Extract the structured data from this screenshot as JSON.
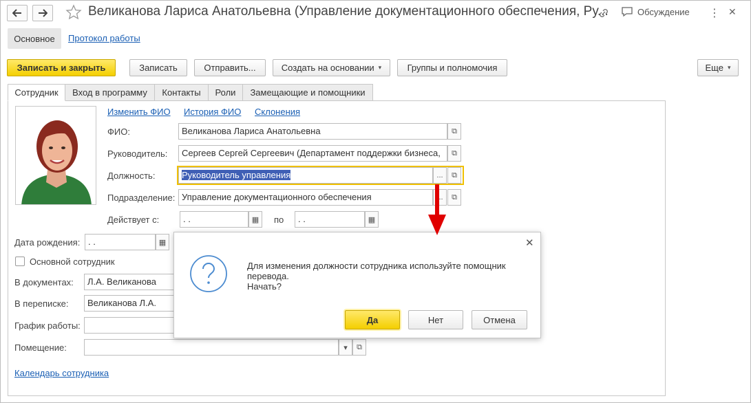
{
  "window": {
    "title": "Великанова Лариса Анатольевна (Управление документационного обеспечения, Ру...",
    "discussion_label": "Обсуждение"
  },
  "sections": {
    "main": "Основное",
    "protocol": "Протокол работы"
  },
  "toolbar": {
    "save_close": "Записать и закрыть",
    "save": "Записать",
    "send": "Отправить...",
    "create_based": "Создать на основании",
    "groups": "Группы и полномочия",
    "more": "Еще"
  },
  "tabs": [
    {
      "label": "Сотрудник"
    },
    {
      "label": "Вход в программу"
    },
    {
      "label": "Контакты"
    },
    {
      "label": "Роли"
    },
    {
      "label": "Замещающие и помощники"
    }
  ],
  "links": {
    "change_name": "Изменить ФИО",
    "name_history": "История ФИО",
    "declensions": "Склонения",
    "calendar": "Календарь сотрудника"
  },
  "form": {
    "fio_label": "ФИО:",
    "fio_value": "Великанова Лариса Анатольевна",
    "manager_label": "Руководитель:",
    "manager_value": "Сергеев Сергей Сергеевич (Департамент поддержки бизнеса,",
    "position_label": "Должность:",
    "position_value": "Руководитель управления",
    "dept_label": "Подразделение:",
    "dept_value": "Управление документационного обеспечения",
    "valid_from_label": "Действует с:",
    "date_empty": " .  .",
    "to_label": "по",
    "birth_label": "Дата рождения:",
    "main_employee_label": "Основной сотрудник",
    "in_docs_label": "В документах:",
    "in_docs_value": "Л.А. Великанова",
    "in_corr_label": "В переписке:",
    "in_corr_value": "Великанова Л.А.",
    "schedule_label": "График работы:",
    "room_label": "Помещение:"
  },
  "dialog": {
    "message_line1": "Для изменения должности сотрудника используйте помощник",
    "message_line2": "перевода.",
    "message_line3": "Начать?",
    "yes": "Да",
    "no": "Нет",
    "cancel": "Отмена"
  },
  "colors": {
    "accent_yellow": "#f4cf00",
    "link_blue": "#1a5fb4",
    "arrow_red": "#e00000",
    "focus_border": "#f0c000"
  }
}
